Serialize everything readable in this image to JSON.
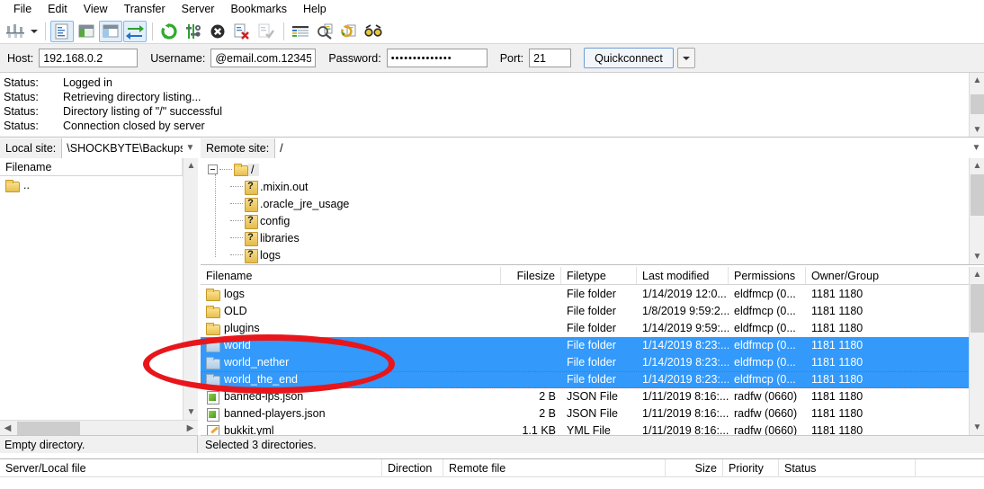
{
  "menu": {
    "items": [
      "File",
      "Edit",
      "View",
      "Transfer",
      "Server",
      "Bookmarks",
      "Help"
    ]
  },
  "toolbar": {
    "buttons": [
      {
        "name": "site-manager-icon",
        "label": "Open the Site Manager",
        "state": "normal"
      },
      {
        "name": "site-manager-dropdown-icon",
        "label": "Site Manager dropdown",
        "state": "caret"
      },
      {
        "name": "toggle-message-log-icon",
        "label": "Toggle message log",
        "state": "active"
      },
      {
        "name": "toggle-local-tree-icon",
        "label": "Toggle local directory tree",
        "state": "normal"
      },
      {
        "name": "toggle-remote-tree-icon",
        "label": "Toggle remote directory tree",
        "state": "active"
      },
      {
        "name": "toggle-transfer-queue-icon",
        "label": "Toggle transfer queue",
        "state": "active"
      },
      {
        "name": "refresh-icon",
        "label": "Refresh file and folder lists",
        "state": "normal"
      },
      {
        "name": "process-queue-icon",
        "label": "Process queue",
        "state": "normal"
      },
      {
        "name": "cancel-operation-icon",
        "label": "Cancel current operation",
        "state": "normal"
      },
      {
        "name": "disconnect-icon",
        "label": "Disconnect from server",
        "state": "normal"
      },
      {
        "name": "reconnect-icon",
        "label": "Reconnect to last used server",
        "state": "disabled"
      },
      {
        "name": "filter-icon",
        "label": "Open directory filters",
        "state": "normal"
      },
      {
        "name": "compare-directories-icon",
        "label": "Directory comparison",
        "state": "normal"
      },
      {
        "name": "synchronized-browsing-icon",
        "label": "Synchronized browsing",
        "state": "normal"
      },
      {
        "name": "find-files-icon",
        "label": "Search remote files",
        "state": "normal"
      }
    ]
  },
  "quickconnect": {
    "host_label": "Host:",
    "host_value": "192.168.0.2",
    "username_label": "Username:",
    "username_value": "@email.com.12345",
    "password_label": "Password:",
    "password_value": "••••••••••••••",
    "port_label": "Port:",
    "port_value": "21",
    "connect_label": "Quickconnect",
    "dropdown_icon": "chevron-down-icon"
  },
  "log": {
    "rows": [
      {
        "key": "Status:",
        "message": "Logged in"
      },
      {
        "key": "Status:",
        "message": "Retrieving directory listing..."
      },
      {
        "key": "Status:",
        "message": "Directory listing of \"/\" successful"
      },
      {
        "key": "Status:",
        "message": "Connection closed by server"
      }
    ]
  },
  "local": {
    "site_label": "Local site:",
    "site_path": "\\SHOCKBYTE\\Backups\\",
    "columns": [
      "Filename"
    ],
    "rows": [
      {
        "icon": "folder-icon",
        "name": ".."
      }
    ],
    "status": "Empty directory."
  },
  "remote": {
    "site_label": "Remote site:",
    "site_path": "/",
    "tree": [
      {
        "name": "/",
        "icon": "folder-icon",
        "level": 0,
        "selected": true,
        "expander": "minus"
      },
      {
        "name": ".mixin.out",
        "icon": "unknown-folder-icon",
        "level": 1
      },
      {
        "name": ".oracle_jre_usage",
        "icon": "unknown-folder-icon",
        "level": 1
      },
      {
        "name": "config",
        "icon": "unknown-folder-icon",
        "level": 1
      },
      {
        "name": "libraries",
        "icon": "unknown-folder-icon",
        "level": 1
      },
      {
        "name": "logs",
        "icon": "unknown-folder-icon",
        "level": 1
      }
    ],
    "columns": [
      {
        "label": "Filename",
        "align": "left"
      },
      {
        "label": "Filesize",
        "align": "right"
      },
      {
        "label": "Filetype",
        "align": "left"
      },
      {
        "label": "Last modified",
        "align": "left"
      },
      {
        "label": "Permissions",
        "align": "left"
      },
      {
        "label": "Owner/Group",
        "align": "left"
      }
    ],
    "sorted_column": "Filename",
    "rows": [
      {
        "icon": "folder-icon",
        "name": "logs",
        "filesize": "",
        "filetype": "File folder",
        "modified": "1/14/2019 12:0...",
        "permissions": "eldfmcp (0...",
        "owner": "1181 1180",
        "selected": false
      },
      {
        "icon": "folder-icon",
        "name": "OLD",
        "filesize": "",
        "filetype": "File folder",
        "modified": "1/8/2019 9:59:2...",
        "permissions": "eldfmcp (0...",
        "owner": "1181 1180",
        "selected": false
      },
      {
        "icon": "folder-icon",
        "name": "plugins",
        "filesize": "",
        "filetype": "File folder",
        "modified": "1/14/2019 9:59:...",
        "permissions": "eldfmcp (0...",
        "owner": "1181 1180",
        "selected": false
      },
      {
        "icon": "folder-icon",
        "name": "world",
        "filesize": "",
        "filetype": "File folder",
        "modified": "1/14/2019 8:23:...",
        "permissions": "eldfmcp (0...",
        "owner": "1181 1180",
        "selected": true
      },
      {
        "icon": "folder-icon",
        "name": "world_nether",
        "filesize": "",
        "filetype": "File folder",
        "modified": "1/14/2019 8:23:...",
        "permissions": "eldfmcp (0...",
        "owner": "1181 1180",
        "selected": true
      },
      {
        "icon": "folder-icon",
        "name": "world_the_end",
        "filesize": "",
        "filetype": "File folder",
        "modified": "1/14/2019 8:23:...",
        "permissions": "eldfmcp (0...",
        "owner": "1181 1180",
        "selected": true,
        "focused": true
      },
      {
        "icon": "json-file-icon",
        "name": "banned-ips.json",
        "filesize": "2 B",
        "filetype": "JSON File",
        "modified": "1/11/2019 8:16:...",
        "permissions": "radfw (0660)",
        "owner": "1181 1180",
        "selected": false
      },
      {
        "icon": "json-file-icon",
        "name": "banned-players.json",
        "filesize": "2 B",
        "filetype": "JSON File",
        "modified": "1/11/2019 8:16:...",
        "permissions": "radfw (0660)",
        "owner": "1181 1180",
        "selected": false
      },
      {
        "icon": "yml-file-icon",
        "name": "bukkit.yml",
        "filesize": "1.1 KB",
        "filetype": "YML File",
        "modified": "1/11/2019 8:16:...",
        "permissions": "radfw (0660)",
        "owner": "1181 1180",
        "selected": false
      }
    ],
    "status": "Selected 3 directories."
  },
  "queue": {
    "columns": [
      {
        "label": "Server/Local file",
        "align": "left"
      },
      {
        "label": "Direction",
        "align": "left"
      },
      {
        "label": "Remote file",
        "align": "left"
      },
      {
        "label": "Size",
        "align": "right"
      },
      {
        "label": "Priority",
        "align": "left"
      },
      {
        "label": "Status",
        "align": "left"
      }
    ],
    "rows": []
  },
  "annotation": {
    "shape": "ellipse",
    "color": "#e8161b",
    "targets": [
      "world",
      "world_nether",
      "world_the_end"
    ]
  },
  "colors": {
    "selection_blue": "#3399fb",
    "annotation_red": "#e8161b",
    "toolbar_active": "#e2effb",
    "chrome_gray": "#f0f0f0"
  }
}
